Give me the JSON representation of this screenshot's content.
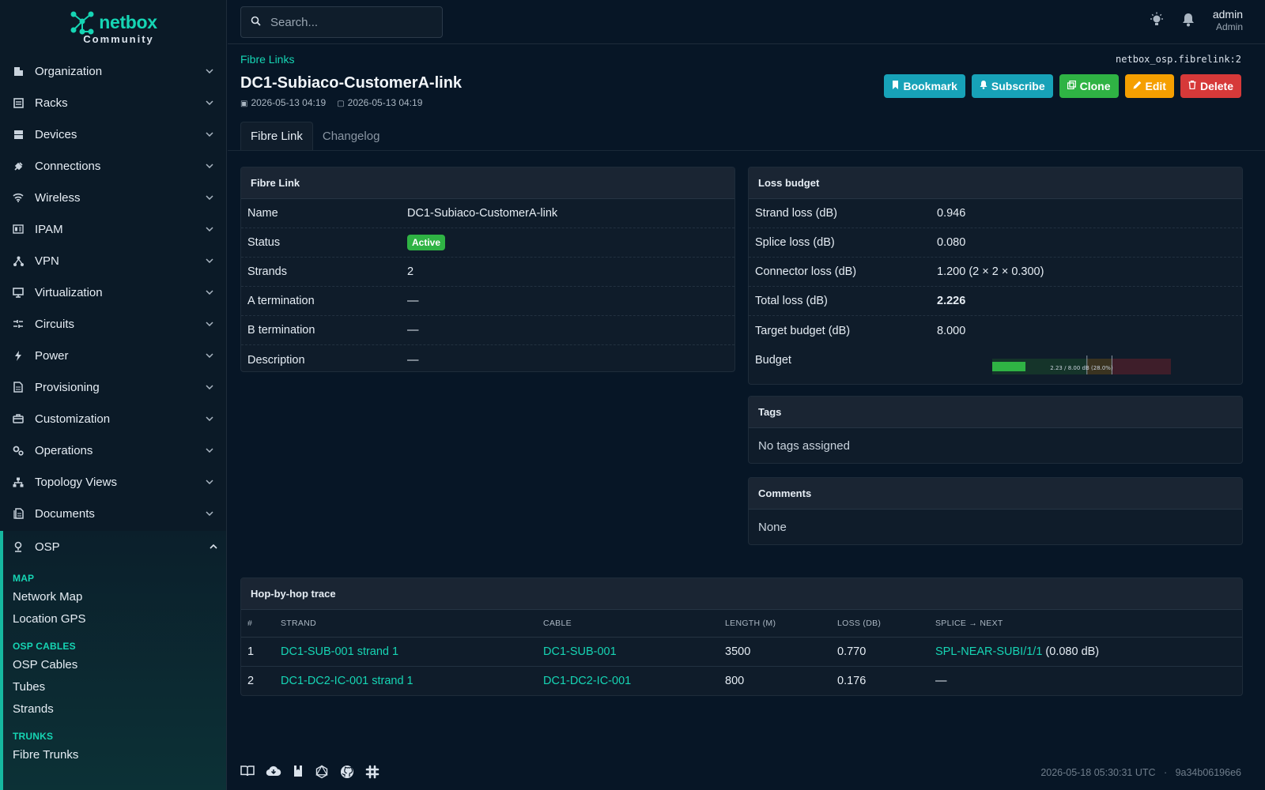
{
  "brand": {
    "name": "netbox",
    "edition": "Community",
    "accent": "#16d5b4"
  },
  "sidebar": {
    "items": [
      {
        "label": "Organization",
        "icon": "building-icon"
      },
      {
        "label": "Racks",
        "icon": "rack-icon"
      },
      {
        "label": "Devices",
        "icon": "server-icon"
      },
      {
        "label": "Connections",
        "icon": "plug-icon"
      },
      {
        "label": "Wireless",
        "icon": "wifi-icon"
      },
      {
        "label": "IPAM",
        "icon": "ip-icon"
      },
      {
        "label": "VPN",
        "icon": "vpn-icon"
      },
      {
        "label": "Virtualization",
        "icon": "monitor-icon"
      },
      {
        "label": "Circuits",
        "icon": "circuit-icon"
      },
      {
        "label": "Power",
        "icon": "bolt-icon"
      },
      {
        "label": "Provisioning",
        "icon": "document-icon"
      },
      {
        "label": "Customization",
        "icon": "toolbox-icon"
      },
      {
        "label": "Operations",
        "icon": "cogs-icon"
      },
      {
        "label": "Topology Views",
        "icon": "sitemap-icon"
      },
      {
        "label": "Documents",
        "icon": "documents-icon"
      }
    ],
    "osp": {
      "label": "OSP",
      "sections": [
        {
          "title": "MAP",
          "links": [
            "Network Map",
            "Location GPS"
          ]
        },
        {
          "title": "OSP CABLES",
          "links": [
            "OSP Cables",
            "Tubes",
            "Strands"
          ]
        },
        {
          "title": "TRUNKS",
          "links": [
            "Fibre Trunks"
          ]
        }
      ]
    }
  },
  "topbar": {
    "search_placeholder": "Search...",
    "user_name": "admin",
    "user_role": "Admin"
  },
  "header": {
    "breadcrumb": "Fibre Links",
    "object_key": "netbox_osp.fibrelink:2",
    "title": "DC1-Subiaco-CustomerA-link",
    "created": "2026-05-13 04:19",
    "modified": "2026-05-13 04:19",
    "actions": [
      {
        "label": "Bookmark",
        "icon": "bookmark-icon",
        "color": "#17a2b8"
      },
      {
        "label": "Subscribe",
        "icon": "bell-icon",
        "color": "#17a2b8"
      },
      {
        "label": "Clone",
        "icon": "copy-icon",
        "color": "#2fb344"
      },
      {
        "label": "Edit",
        "icon": "pencil-icon",
        "color": "#f59f00"
      },
      {
        "label": "Delete",
        "icon": "trash-icon",
        "color": "#d63939"
      }
    ],
    "tabs": [
      "Fibre Link",
      "Changelog"
    ]
  },
  "fibre_link": {
    "title": "Fibre Link",
    "rows": [
      {
        "key": "Name",
        "value": "DC1-Subiaco-CustomerA-link"
      },
      {
        "key": "Status",
        "value": "Active"
      },
      {
        "key": "Strands",
        "value": "2"
      },
      {
        "key": "A termination",
        "value": "—"
      },
      {
        "key": "B termination",
        "value": "—"
      },
      {
        "key": "Description",
        "value": "—"
      }
    ]
  },
  "loss_budget": {
    "title": "Loss budget",
    "rows": [
      {
        "key": "Strand loss (dB)",
        "value": "0.946"
      },
      {
        "key": "Splice loss (dB)",
        "value": "0.080"
      },
      {
        "key": "Connector loss (dB)",
        "value": "1.200 (2 × 2 × 0.300)"
      },
      {
        "key": "Total loss (dB)",
        "value": "2.226"
      },
      {
        "key": "Target budget (dB)",
        "value": "8.000"
      }
    ],
    "budget_label": "Budget",
    "budget_bar": {
      "caption": "2.23 / 8.00 dB (28.0%)",
      "fill_fraction": 0.186,
      "colors": {
        "fill": "#2fb344",
        "ok": "#15342a",
        "warn": "#3a3320",
        "bad": "#3e1e2a"
      }
    }
  },
  "tags": {
    "title": "Tags",
    "text": "No tags assigned"
  },
  "comments": {
    "title": "Comments",
    "text": "None"
  },
  "trace": {
    "title": "Hop-by-hop trace",
    "columns": [
      "#",
      "STRAND",
      "CABLE",
      "LENGTH (M)",
      "LOSS (DB)",
      "SPLICE → NEXT"
    ],
    "rows": [
      {
        "n": "1",
        "strand": "DC1-SUB-001 strand 1",
        "cable": "DC1-SUB-001",
        "length": "3500",
        "loss": "0.770",
        "splice": "SPL-NEAR-SUBI/1/1",
        "splice_loss": "(0.080 dB)"
      },
      {
        "n": "2",
        "strand": "DC1-DC2-IC-001 strand 1",
        "cable": "DC1-DC2-IC-001",
        "length": "800",
        "loss": "0.176",
        "splice": "—",
        "splice_loss": ""
      }
    ]
  },
  "footer": {
    "timestamp": "2026-05-18 05:30:31 UTC",
    "separator": "·",
    "commit": "9a34b06196e6"
  }
}
